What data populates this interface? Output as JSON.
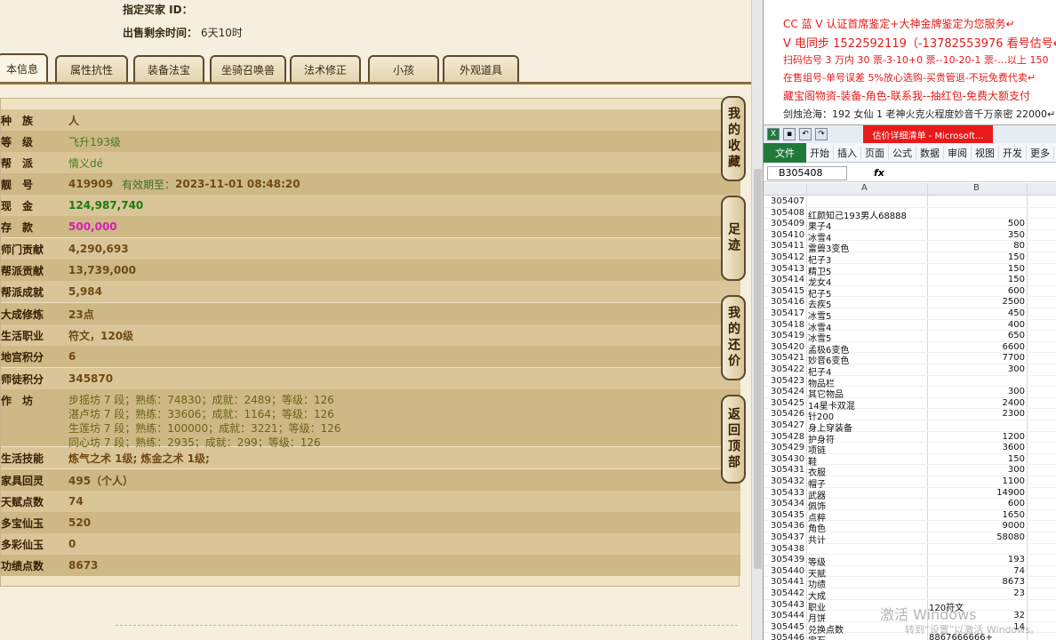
{
  "header": {
    "buyer_label": "指定买家 ID：",
    "time_label": "出售剩余时间：",
    "time_value": "6天10时"
  },
  "tabs": [
    {
      "label": "本信息",
      "active": true
    },
    {
      "label": "属性抗性",
      "active": false
    },
    {
      "label": "装备法宝",
      "active": false
    },
    {
      "label": "坐骑召唤兽",
      "active": false
    },
    {
      "label": "法术修正",
      "active": false
    },
    {
      "label": "小孩",
      "active": false
    },
    {
      "label": "外观道具",
      "active": false
    }
  ],
  "info_rows": [
    {
      "key": "种　族",
      "value": "人"
    },
    {
      "key": "等　级",
      "value": "飞升193级"
    },
    {
      "key": "帮　派",
      "value": "情义dé"
    },
    {
      "key": "靓　号",
      "value": "419909",
      "extra_label": "有效期至：",
      "extra_value": "2023-11-01 08:48:20"
    },
    {
      "key": "现　金",
      "value": "124,987,740"
    },
    {
      "key": "存　款",
      "value": "500,000"
    },
    {
      "key": "师门贡献",
      "value": "4,290,693"
    },
    {
      "key": "帮派贡献",
      "value": "13,739,000"
    },
    {
      "key": "帮派成就",
      "value": "5,984"
    },
    {
      "key": "大成修炼",
      "value": "23点"
    },
    {
      "key": "生活职业",
      "value": "符文，120级"
    },
    {
      "key": "地宫积分",
      "value": "6"
    },
    {
      "key": "师徒积分",
      "value": "345870"
    },
    {
      "key": "作　坊"
    },
    {
      "key": "生活技能",
      "value": "炼气之术 1级; 炼金之术 1级;"
    },
    {
      "key": "家具回灵",
      "value": "495（个人）"
    },
    {
      "key": "天赋点数",
      "value": "74"
    },
    {
      "key": "多宝仙玉",
      "value": "520"
    },
    {
      "key": "多彩仙玉",
      "value": "0"
    },
    {
      "key": "功绩点数",
      "value": "8673"
    }
  ],
  "workshops": [
    "步摇坊 7 段；熟练：74830；成就：2489；等级：126",
    "湛卢坊 7 段；熟练：33606；成就：1164；等级：126",
    "生莲坊 7 段；熟练：100000；成就：3221；等级：126",
    "同心坊 7 段；熟练：2935；成就：299；等级：126"
  ],
  "side_buttons": [
    {
      "label": "我的收藏"
    },
    {
      "label": "足迹"
    },
    {
      "label": "我的还价"
    },
    {
      "label": "返回顶部"
    }
  ],
  "chat_lines": [
    "CC 蓝 V 认证首席鉴定+大神金牌鉴定为您服务↵",
    "V 电同步 1522592119（-13782553976 看号估号↵",
    "扫码估号 3 万内 30 票-3-10+0 票--10-20-1 票-…以上 150",
    "在售组号-单号误差 5%放心选购-买贵管退-不玩免费代卖↵",
    "藏宝阁物资-装备-角色-联系我--抽红包-免费大额支付",
    "剑烛沧海：192 女仙 1 老神火克火程度妙音千万亲密 22000↵"
  ],
  "excel": {
    "window_title": "估价详细清单 - Microsoft...",
    "name_box": "B305408",
    "fx": "fx",
    "file_tab": "文件",
    "ribbon_tabs": [
      "开始",
      "插入",
      "页面",
      "公式",
      "数据",
      "审阅",
      "视图",
      "开发",
      "更多"
    ],
    "col_a": "A",
    "col_b": "B",
    "rows": [
      {
        "n": "305407",
        "a": "",
        "b": ""
      },
      {
        "n": "305408",
        "a": "红颜知己193男人68888",
        "b": ""
      },
      {
        "n": "305409",
        "a": "果子4",
        "b": "500"
      },
      {
        "n": "305410",
        "a": "冰雪4",
        "b": "350"
      },
      {
        "n": "305411",
        "a": "雷兽3变色",
        "b": "80"
      },
      {
        "n": "305412",
        "a": "杞子3",
        "b": "150"
      },
      {
        "n": "305413",
        "a": "精卫5",
        "b": "150"
      },
      {
        "n": "305414",
        "a": "龙女4",
        "b": "150"
      },
      {
        "n": "305415",
        "a": "杞子5",
        "b": "600"
      },
      {
        "n": "305416",
        "a": "去疾5",
        "b": "2500"
      },
      {
        "n": "305417",
        "a": "冰雪5",
        "b": "450"
      },
      {
        "n": "305418",
        "a": "冰雪4",
        "b": "400"
      },
      {
        "n": "305419",
        "a": "冰雪5",
        "b": "650"
      },
      {
        "n": "305420",
        "a": "孟极6变色",
        "b": "6600"
      },
      {
        "n": "305421",
        "a": "妙音6变色",
        "b": "7700"
      },
      {
        "n": "305422",
        "a": "杞子4",
        "b": "300"
      },
      {
        "n": "305423",
        "a": "物品栏",
        "b": ""
      },
      {
        "n": "305424",
        "a": "其它物品",
        "b": "300"
      },
      {
        "n": "305425",
        "a": "14星卡双混",
        "b": "2400"
      },
      {
        "n": "305426",
        "a": "针200",
        "b": "2300"
      },
      {
        "n": "305427",
        "a": "身上穿装备",
        "b": ""
      },
      {
        "n": "305428",
        "a": "护身符",
        "b": "1200"
      },
      {
        "n": "305429",
        "a": "项链",
        "b": "3600"
      },
      {
        "n": "305430",
        "a": "鞋",
        "b": "150"
      },
      {
        "n": "305431",
        "a": "衣服",
        "b": "300"
      },
      {
        "n": "305432",
        "a": "帽子",
        "b": "1100"
      },
      {
        "n": "305433",
        "a": "武器",
        "b": "14900"
      },
      {
        "n": "305434",
        "a": "佩饰",
        "b": "600"
      },
      {
        "n": "305435",
        "a": "点粹",
        "b": "1650"
      },
      {
        "n": "305436",
        "a": "角色",
        "b": "9000"
      },
      {
        "n": "305437",
        "a": "共计",
        "b": "58080"
      },
      {
        "n": "305438",
        "a": "",
        "b": ""
      },
      {
        "n": "305439",
        "a": "等级",
        "b": "193"
      },
      {
        "n": "305440",
        "a": "天赋",
        "b": "74"
      },
      {
        "n": "305441",
        "a": "功绩",
        "b": "8673"
      },
      {
        "n": "305442",
        "a": "大成",
        "b": "23"
      },
      {
        "n": "305443",
        "a": "职业",
        "b": "120符文",
        "b_left": true
      },
      {
        "n": "305444",
        "a": "月饼",
        "b": "32"
      },
      {
        "n": "305445",
        "a": "兑换点数",
        "b": "14"
      },
      {
        "n": "305446",
        "a": "宝石",
        "b": "8867666666+",
        "b_left": true
      }
    ]
  },
  "watermark": {
    "line1": "激活 Windows",
    "line2": "转到“设置”以激活 Windows。"
  }
}
